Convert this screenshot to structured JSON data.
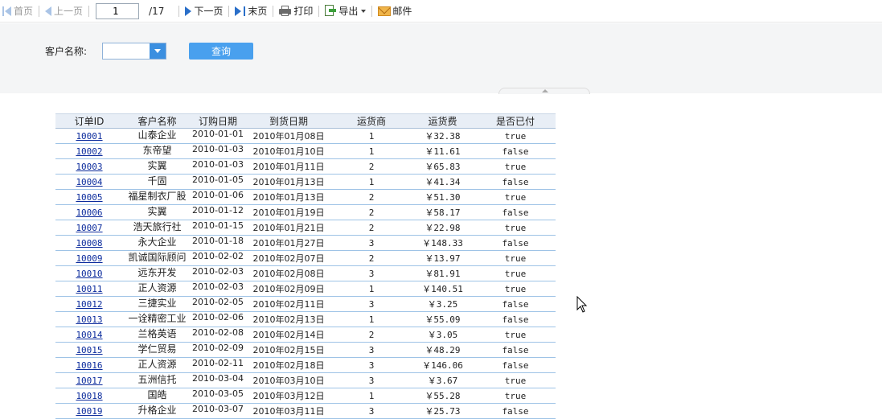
{
  "toolbar": {
    "first": "首页",
    "prev": "上一页",
    "page": "1",
    "total": "/17",
    "next": "下一页",
    "last": "末页",
    "print": "打印",
    "export": "导出",
    "mail": "邮件"
  },
  "filter": {
    "label": "客户名称:",
    "value": "",
    "query": "查询"
  },
  "table": {
    "headers": [
      "订单ID",
      "客户名称",
      "订购日期",
      "到货日期",
      "运货商",
      "运货费",
      "是否已付"
    ],
    "rows": [
      {
        "id": "10001",
        "customer": "山泰企业",
        "order_date": "2010-01-01",
        "arrive_date": "2010年01月08日",
        "shipper": "1",
        "freight": "￥32.38",
        "paid": "true"
      },
      {
        "id": "10002",
        "customer": "东帝望",
        "order_date": "2010-01-03",
        "arrive_date": "2010年01月10日",
        "shipper": "1",
        "freight": "￥11.61",
        "paid": "false"
      },
      {
        "id": "10003",
        "customer": "实翼",
        "order_date": "2010-01-03",
        "arrive_date": "2010年01月11日",
        "shipper": "2",
        "freight": "￥65.83",
        "paid": "true"
      },
      {
        "id": "10004",
        "customer": "千固",
        "order_date": "2010-01-05",
        "arrive_date": "2010年01月13日",
        "shipper": "1",
        "freight": "￥41.34",
        "paid": "false"
      },
      {
        "id": "10005",
        "customer": "福星制衣厂股",
        "order_date": "2010-01-06",
        "arrive_date": "2010年01月13日",
        "shipper": "2",
        "freight": "￥51.30",
        "paid": "true"
      },
      {
        "id": "10006",
        "customer": "实翼",
        "order_date": "2010-01-12",
        "arrive_date": "2010年01月19日",
        "shipper": "2",
        "freight": "￥58.17",
        "paid": "false"
      },
      {
        "id": "10007",
        "customer": "浩天旅行社",
        "order_date": "2010-01-15",
        "arrive_date": "2010年01月21日",
        "shipper": "2",
        "freight": "￥22.98",
        "paid": "true"
      },
      {
        "id": "10008",
        "customer": "永大企业",
        "order_date": "2010-01-18",
        "arrive_date": "2010年01月27日",
        "shipper": "3",
        "freight": "￥148.33",
        "paid": "false"
      },
      {
        "id": "10009",
        "customer": "凯诚国际顾问",
        "order_date": "2010-02-02",
        "arrive_date": "2010年02月07日",
        "shipper": "2",
        "freight": "￥13.97",
        "paid": "true"
      },
      {
        "id": "10010",
        "customer": "远东开发",
        "order_date": "2010-02-03",
        "arrive_date": "2010年02月08日",
        "shipper": "3",
        "freight": "￥81.91",
        "paid": "true"
      },
      {
        "id": "10011",
        "customer": "正人资源",
        "order_date": "2010-02-03",
        "arrive_date": "2010年02月09日",
        "shipper": "1",
        "freight": "￥140.51",
        "paid": "true"
      },
      {
        "id": "10012",
        "customer": "三捷实业",
        "order_date": "2010-02-05",
        "arrive_date": "2010年02月11日",
        "shipper": "3",
        "freight": "￥3.25",
        "paid": "false"
      },
      {
        "id": "10013",
        "customer": "一诠精密工业",
        "order_date": "2010-02-06",
        "arrive_date": "2010年02月13日",
        "shipper": "1",
        "freight": "￥55.09",
        "paid": "false"
      },
      {
        "id": "10014",
        "customer": "兰格英语",
        "order_date": "2010-02-08",
        "arrive_date": "2010年02月14日",
        "shipper": "2",
        "freight": "￥3.05",
        "paid": "true"
      },
      {
        "id": "10015",
        "customer": "学仁贸易",
        "order_date": "2010-02-09",
        "arrive_date": "2010年02月15日",
        "shipper": "3",
        "freight": "￥48.29",
        "paid": "false"
      },
      {
        "id": "10016",
        "customer": "正人资源",
        "order_date": "2010-02-11",
        "arrive_date": "2010年02月18日",
        "shipper": "3",
        "freight": "￥146.06",
        "paid": "false"
      },
      {
        "id": "10017",
        "customer": "五洲信托",
        "order_date": "2010-03-04",
        "arrive_date": "2010年03月10日",
        "shipper": "3",
        "freight": "￥3.67",
        "paid": "true"
      },
      {
        "id": "10018",
        "customer": "国皓",
        "order_date": "2010-03-05",
        "arrive_date": "2010年03月12日",
        "shipper": "1",
        "freight": "￥55.28",
        "paid": "true"
      },
      {
        "id": "10019",
        "customer": "升格企业",
        "order_date": "2010-03-07",
        "arrive_date": "2010年03月11日",
        "shipper": "3",
        "freight": "￥25.73",
        "paid": "false"
      }
    ]
  },
  "colors": {
    "link": "#0a2a9c",
    "query_button": "#49a0ee",
    "row_border": "#9ec3e6",
    "header_bg": "#e8eef6"
  }
}
